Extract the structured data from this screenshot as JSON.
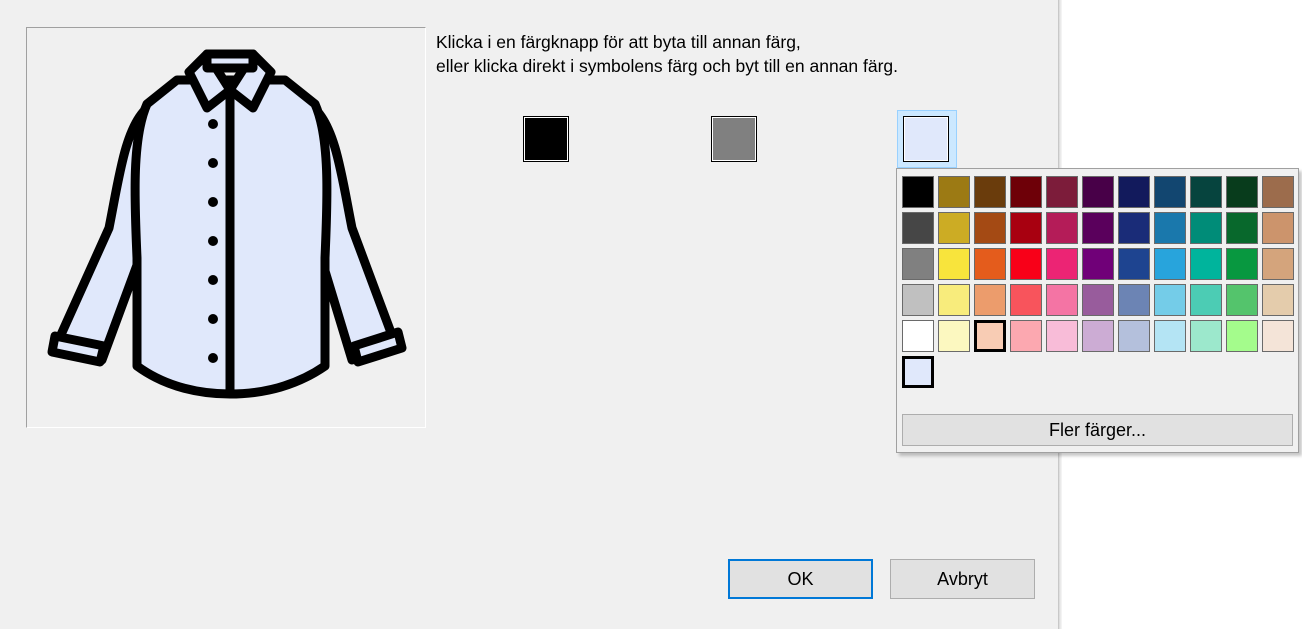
{
  "instructions": {
    "line1": "Klicka i en färgknapp för att byta till annan färg,",
    "line2": "eller klicka direkt i symbolens färg och byt till en annan färg."
  },
  "preview": {
    "symbol": "shirt-icon",
    "shirt_fill": "#e0e8fb",
    "outline": "#000000"
  },
  "color_buttons": [
    {
      "name": "color-button-1",
      "color": "#000000"
    },
    {
      "name": "color-button-2",
      "color": "#808080"
    },
    {
      "name": "color-button-3",
      "color": "#e0e8fb",
      "active": true
    }
  ],
  "palette": {
    "rows": [
      [
        "#000000",
        "#9c7a14",
        "#6a3c0c",
        "#6e0008",
        "#7c1c3a",
        "#480048",
        "#121a5c",
        "#124670",
        "#06443e",
        "#083c1c",
        "#9c6c4c"
      ],
      [
        "#464646",
        "#ccac24",
        "#a44a14",
        "#a80010",
        "#b41c58",
        "#5a005c",
        "#1a2c78",
        "#1a78ac",
        "#008c78",
        "#08682c",
        "#cc946c"
      ],
      [
        "#808080",
        "#f8e43c",
        "#e45c1c",
        "#f80018",
        "#ec2474",
        "#700078",
        "#1e4490",
        "#28a4dc",
        "#00b49c",
        "#089840",
        "#d4a47c"
      ],
      [
        "#c0c0c0",
        "#f8ec7c",
        "#ec9c6c",
        "#f8545c",
        "#f474a4",
        "#985c9c",
        "#6c84b4",
        "#74cce8",
        "#4cccb4",
        "#54c46c",
        "#e4ccac"
      ],
      [
        "#ffffff",
        "#fcf8c0",
        "#f8ccb4",
        "#fca8b0",
        "#f8bcd8",
        "#ccacd4",
        "#b4c0dc",
        "#b4e4f4",
        "#9ce8cc",
        "#a4fc8c",
        "#f4e4d8"
      ]
    ],
    "selected": {
      "row": 4,
      "col": 2
    },
    "custom_colors": [
      "#e0e8fb"
    ],
    "more_colors_label": "Fler färger..."
  },
  "buttons": {
    "ok_label": "OK",
    "cancel_label": "Avbryt"
  }
}
